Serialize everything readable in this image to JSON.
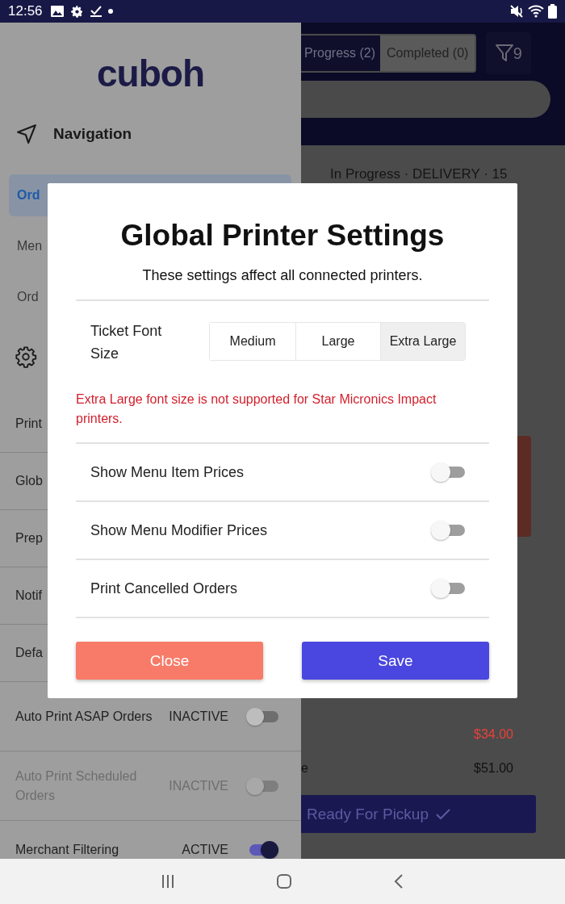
{
  "status_bar": {
    "time": "12:56"
  },
  "drawer": {
    "logo": "cuboh",
    "heading": "Navigation",
    "items": [
      {
        "label": "Ord",
        "selected": true
      },
      {
        "label": "Men",
        "selected": false
      },
      {
        "label": "Ord",
        "selected": false
      }
    ],
    "settings": [
      {
        "label": "Print"
      },
      {
        "label": "Glob"
      },
      {
        "label": "Prep"
      },
      {
        "label": "Notif"
      },
      {
        "label": "Defa"
      },
      {
        "label": "Auto Print ASAP Orders",
        "status": "INACTIVE",
        "on": false,
        "disabled": false
      },
      {
        "label": "Auto Print Scheduled Orders",
        "status": "INACTIVE",
        "on": false,
        "disabled": true
      },
      {
        "label": "Merchant Filtering",
        "status": "ACTIVE",
        "on": true,
        "disabled": false
      }
    ]
  },
  "orders": {
    "tabs": [
      {
        "label": "Progress (2)",
        "selected": true
      },
      {
        "label": "Completed (0)",
        "selected": false
      }
    ],
    "filter_count": "9",
    "order_header": "In Progress · DELIVERY · 15",
    "lines": [
      {
        "price": "$34.00",
        "color": "#e8413a"
      },
      {
        "label": "e",
        "price": "$51.00",
        "color": "#111111"
      }
    ],
    "action": "Ready For Pickup"
  },
  "modal": {
    "title": "Global Printer Settings",
    "subtitle": "These settings affect all connected printers.",
    "font_size": {
      "label": "Ticket Font Size",
      "options": [
        {
          "label": "Medium",
          "selected": false
        },
        {
          "label": "Large",
          "selected": false
        },
        {
          "label": "Extra Large",
          "selected": true
        }
      ]
    },
    "warning": "Extra Large font size is not supported for Star Micronics Impact printers.",
    "toggles": [
      {
        "label": "Show Menu Item Prices",
        "on": false
      },
      {
        "label": "Show Menu Modifier Prices",
        "on": false
      },
      {
        "label": "Print Cancelled Orders",
        "on": false
      }
    ],
    "buttons": [
      {
        "label": "Close",
        "kind": "secondary"
      },
      {
        "label": "Save",
        "kind": "primary"
      }
    ]
  }
}
